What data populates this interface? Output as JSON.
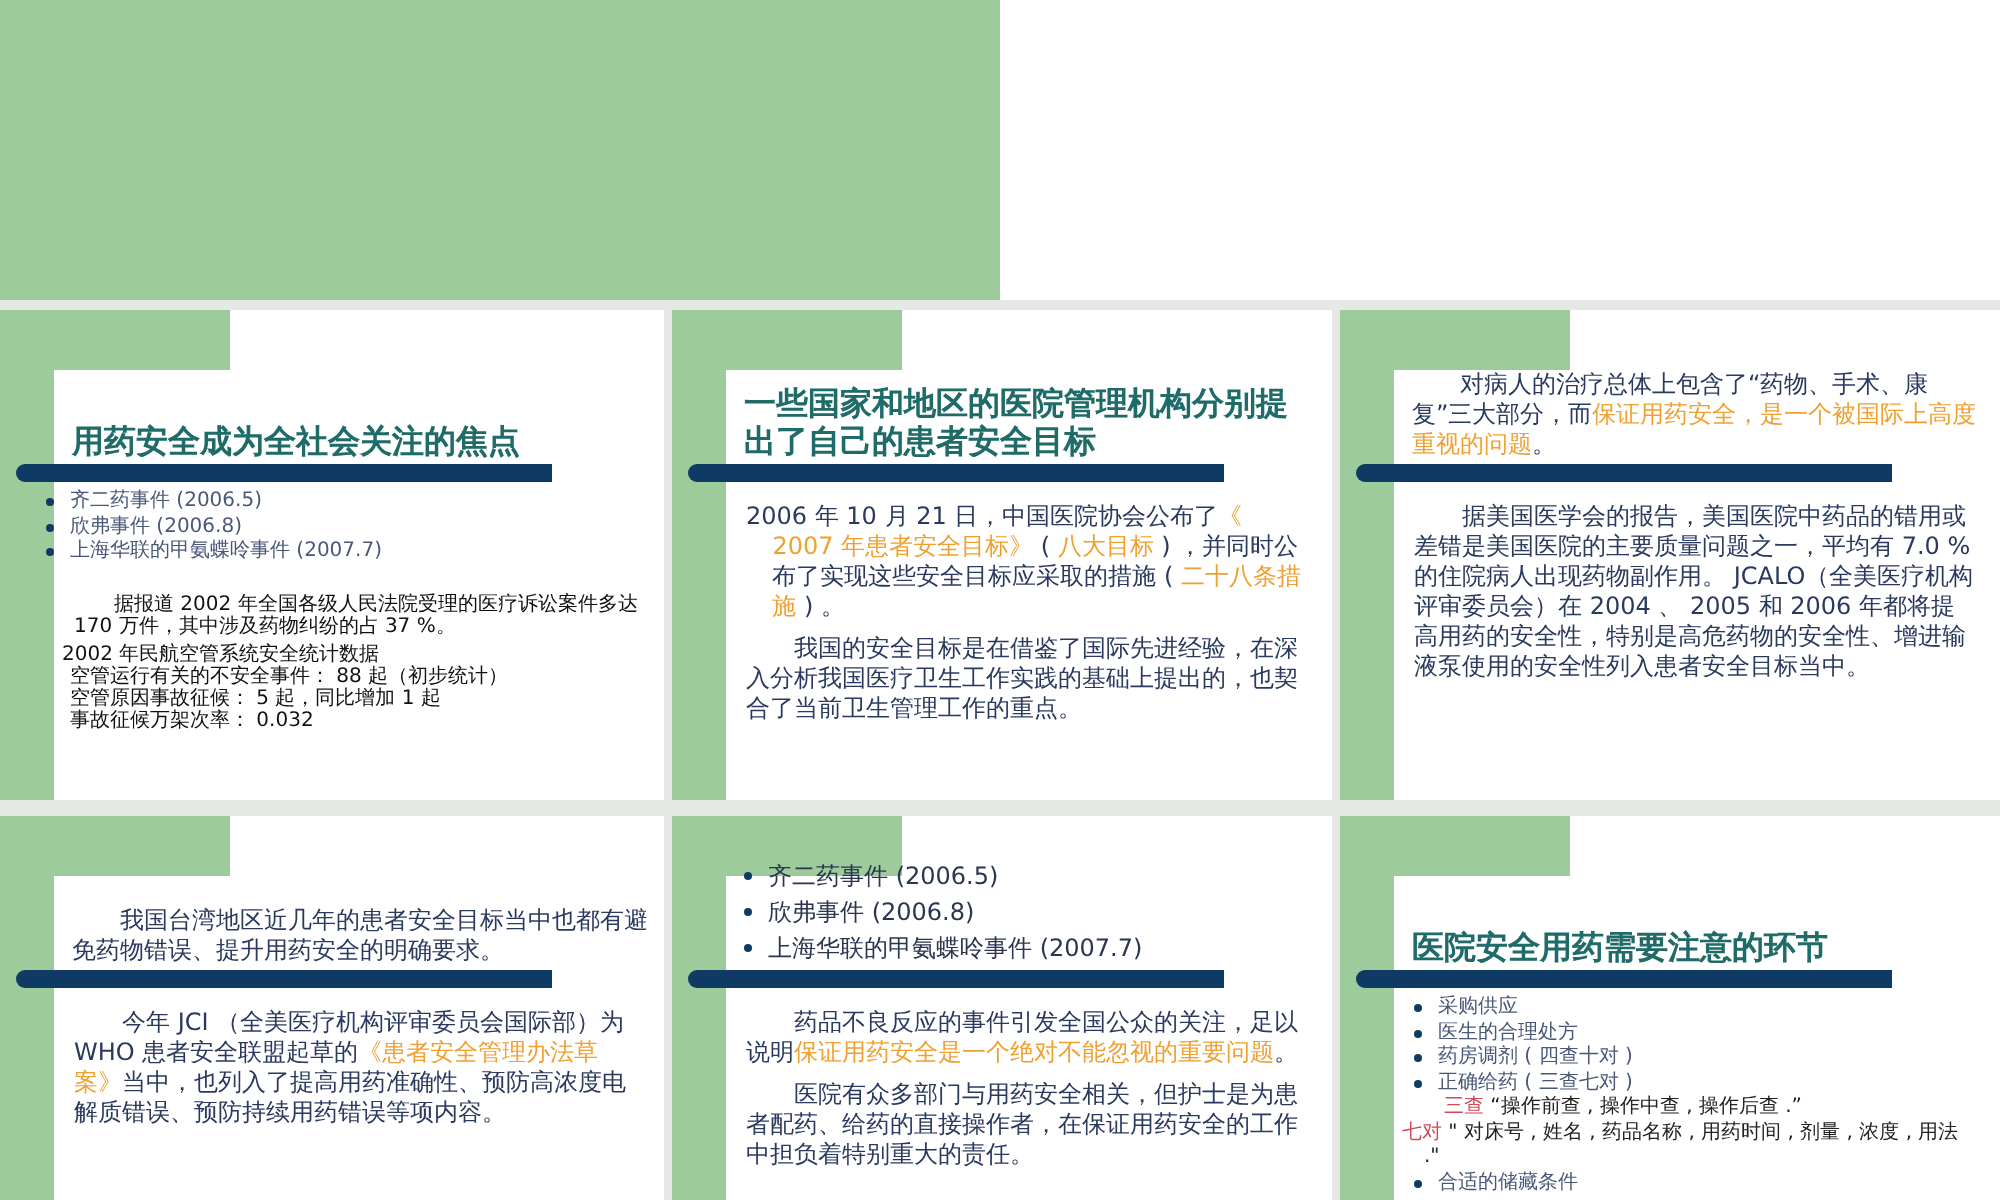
{
  "slides": [
    {
      "header": [
        {
          "kind": "title",
          "text": "用药安全成为全社会关注的焦点"
        }
      ],
      "body": [
        {
          "kind": "bullets",
          "items": [
            "齐二药事件 (2006.5)",
            "欣弗事件 (2006.8)",
            "上海华联的甲氨蝶呤事件 (2007.7)"
          ]
        },
        {
          "kind": "paragraph",
          "segments": [
            {
              "text": "据报道 2002 年全国各级人民法院受理的医疗诉讼案件多达 170 万件，其中涉及药物纠纷的占 37 %。",
              "kind": "plain"
            }
          ]
        },
        {
          "kind": "lines",
          "items": [
            "2002 年民航空管系统安全统计数据",
            "空管运行有关的不安全事件： 88 起（初步统计）",
            "空管原因事故征候： 5 起，同比增加 1 起",
            "事故征候万架次率： 0.032"
          ]
        }
      ]
    },
    {
      "header": [
        {
          "kind": "title",
          "text": "一些国家和地区的医院管理机构分别提出了自己的患者安全目标"
        }
      ],
      "body": [
        {
          "kind": "hanging",
          "segments": [
            {
              "text": "2006 年 10 月 21 日，中国医院协会公布了",
              "kind": "plain"
            },
            {
              "text": "《 2007 年患者安全目标》",
              "kind": "highlight"
            },
            {
              "text": " ( ",
              "kind": "plain"
            },
            {
              "text": "八大目标",
              "kind": "highlight"
            },
            {
              "text": " ) ，并同时公布了实现这些安全目标应采取的措施 ( ",
              "kind": "plain"
            },
            {
              "text": "二十八条措施",
              "kind": "highlight"
            },
            {
              "text": " ) 。",
              "kind": "plain"
            }
          ]
        },
        {
          "kind": "paragraph",
          "segments": [
            {
              "text": "我国的安全目标是在借鉴了国际先进经验，在深入分析我国医疗卫生工作实践的基础上提出的，也契合了当前卫生管理工作的重点。",
              "kind": "plain"
            }
          ]
        }
      ]
    },
    {
      "header": [
        {
          "kind": "paragraph",
          "segments": [
            {
              "text": "对病人的治疗总体上包含了“药物、手术、康复”三大部分，而",
              "kind": "plain"
            },
            {
              "text": "保证用药安全，是一个被国际上高度重视的问题",
              "kind": "highlight"
            },
            {
              "text": "。",
              "kind": "plain"
            }
          ]
        }
      ],
      "body": [
        {
          "kind": "paragraph",
          "segments": [
            {
              "text": "据美国医学会的报告，美国医院中药品的错用或差错是美国医院的主要质量问题之一，平均有 7.0 %的住院病人出现药物副作用。 JCALO（全美医疗机构评审委员会）在 2004 、 2005 和 2006 年都将提高用药的安全性，特别是高危药物的安全性、增进输液泵使用的安全性列入患者安全目标当中。",
              "kind": "plain"
            }
          ]
        }
      ]
    },
    {
      "header": [
        {
          "kind": "paragraph",
          "segments": [
            {
              "text": "我国台湾地区近几年的患者安全目标当中也都有避免药物错误、提升用药安全的明确要求。",
              "kind": "plain"
            }
          ]
        }
      ],
      "body": [
        {
          "kind": "paragraph",
          "segments": [
            {
              "text": "今年 JCI （全美医疗机构评审委员会国际部）为 WHO 患者安全联盟起草的",
              "kind": "plain"
            },
            {
              "text": "《患者安全管理办法草案》",
              "kind": "highlight"
            },
            {
              "text": "当中，也列入了提高用药准确性、预防高浓度电解质错误、预防持续用药错误等项内容。",
              "kind": "plain"
            }
          ]
        }
      ]
    },
    {
      "header": [
        {
          "kind": "bullets",
          "items": [
            "齐二药事件 (2006.5)",
            "欣弗事件 (2006.8)",
            "上海华联的甲氨蝶呤事件 (2007.7)"
          ]
        }
      ],
      "body": [
        {
          "kind": "paragraph",
          "segments": [
            {
              "text": "药品不良反应的事件引发全国公众的关注，足以说明",
              "kind": "plain"
            },
            {
              "text": "保证用药安全是一个绝对不能忽视的重要问题",
              "kind": "highlight"
            },
            {
              "text": "。",
              "kind": "plain"
            }
          ]
        },
        {
          "kind": "paragraph",
          "segments": [
            {
              "text": "医院有众多部门与用药安全相关，但护士是为患者配药、给药的直接操作者，在保证用药安全的工作中担负着特别重大的责任。",
              "kind": "plain"
            }
          ]
        }
      ]
    },
    {
      "header": [
        {
          "kind": "title",
          "text": "医院安全用药需要注意的环节"
        }
      ],
      "body": [
        {
          "kind": "bullets",
          "items": [
            "采购供应",
            "医生的合理处方",
            "药房调剂 ( 四查十对 )",
            "正确给药 ( 三查七对 )"
          ]
        },
        {
          "kind": "paragraph",
          "segments": [
            {
              "text": "三查",
              "kind": "label"
            },
            {
              "text": " “操作前查 , 操作中查 , 操作后查 .”",
              "kind": "plain"
            }
          ]
        },
        {
          "kind": "hanging",
          "segments": [
            {
              "text": "七对",
              "kind": "label"
            },
            {
              "text": " \" 对床号 , 姓名 , 药品名称 , 用药时间 , 剂量 , 浓度 , 用法 .\"",
              "kind": "plain"
            }
          ]
        },
        {
          "kind": "bullets",
          "items": [
            "合适的储藏条件"
          ]
        }
      ]
    }
  ]
}
